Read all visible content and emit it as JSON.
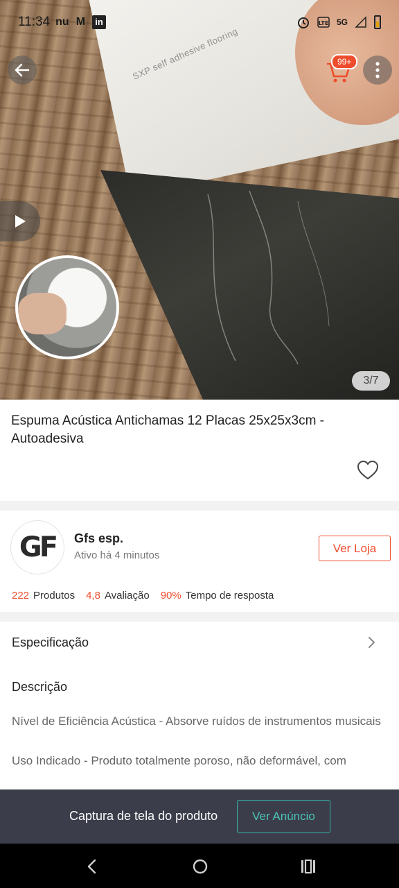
{
  "status_bar": {
    "time": "11:34",
    "app_icons": [
      "nu",
      "M",
      "in"
    ],
    "network": "5G"
  },
  "gallery": {
    "watermark": "SXP self adhesive flooring",
    "page_counter": "3/7",
    "cart_badge": "99+"
  },
  "product": {
    "title": "Espuma Acústica Antichamas 12 Placas 25x25x3cm - Autoadesiva"
  },
  "shop": {
    "logo_text": "GF",
    "name": "Gfs esp.",
    "active_status": "Ativo há 4 minutos",
    "visit_label": "Ver Loja",
    "stats": [
      {
        "value": "222",
        "label": "Produtos"
      },
      {
        "value": "4,8",
        "label": "Avaliação"
      },
      {
        "value": "90%",
        "label": "Tempo de resposta"
      }
    ]
  },
  "specification": {
    "label": "Especificação"
  },
  "description": {
    "heading": "Descrição",
    "paragraph_1": "Nível de Eficiência Acústica - Absorve ruídos de instrumentos musicais",
    "paragraph_2": "Uso Indicado - Produto totalmente poroso, não deformável, com"
  },
  "banner": {
    "text": "Captura de tela do produto",
    "button_label": "Ver Anúncio"
  },
  "colors": {
    "accent": "#ee4d2d",
    "banner_bg": "#3b3d4a",
    "banner_button": "#4cc3b5"
  }
}
